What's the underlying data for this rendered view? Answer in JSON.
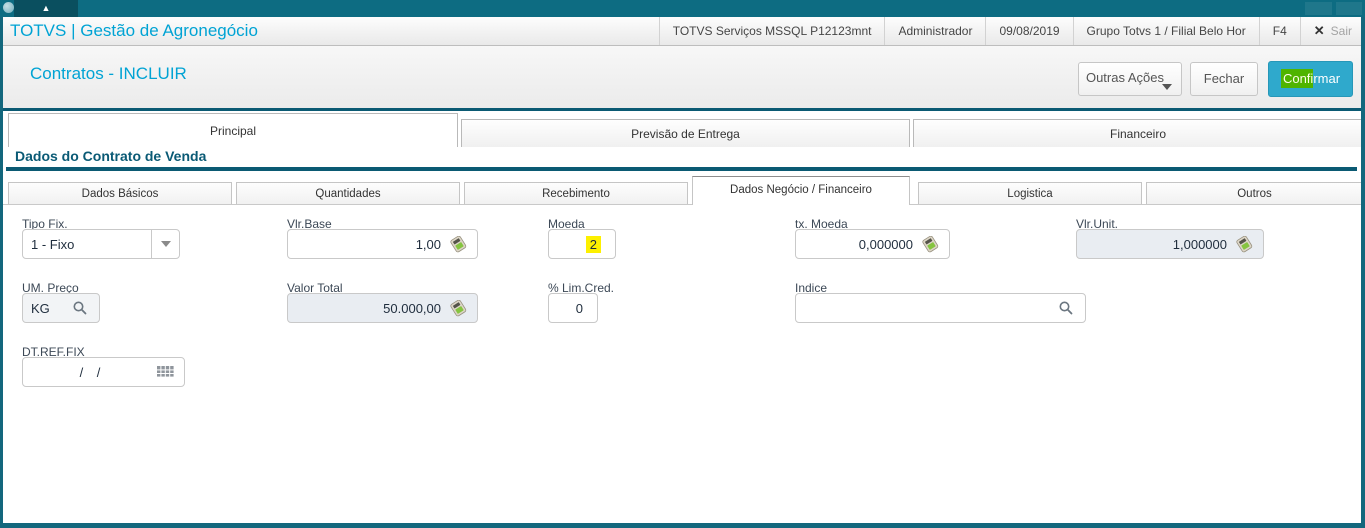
{
  "window": {
    "tab_indicator": "▲"
  },
  "titlebar": {
    "app_title": "TOTVS | Gestão de Agronegócio",
    "items": [
      "TOTVS Serviços MSSQL P12123mnt",
      "Administrador",
      "09/08/2019",
      "Grupo Totvs 1 / Filial Belo Hor",
      "F4"
    ],
    "close_symbol": "✕",
    "exit_label": "Sair"
  },
  "header": {
    "page_title": "Contratos - INCLUIR",
    "other_actions_label": "Outras Ações",
    "close_label": "Fechar",
    "confirm_label_highlight": "Confi",
    "confirm_label_rest": "rmar"
  },
  "tabs": [
    {
      "label": "Principal",
      "active": true
    },
    {
      "label": "Previsão de Entrega",
      "active": false
    },
    {
      "label": "Financeiro",
      "active": false
    }
  ],
  "section": {
    "title": "Dados do Contrato de Venda"
  },
  "subtabs": [
    {
      "label": "Dados Básicos",
      "active": false
    },
    {
      "label": "Quantidades",
      "active": false
    },
    {
      "label": "Recebimento",
      "active": false
    },
    {
      "label": "Dados Negócio / Financeiro",
      "active": true
    },
    {
      "label": "Logistica",
      "active": false
    },
    {
      "label": "Outros",
      "active": false
    }
  ],
  "form": {
    "tipo_fix": {
      "label": "Tipo Fix.",
      "value": "1 - Fixo"
    },
    "vlr_base": {
      "label": "Vlr.Base",
      "value": "1,00"
    },
    "moeda": {
      "label": "Moeda",
      "value": "2",
      "highlighted": true
    },
    "tx_moeda": {
      "label": "tx. Moeda",
      "value": "0,000000"
    },
    "vlr_unit": {
      "label": "Vlr.Unit.",
      "value": "1,000000",
      "disabled": true
    },
    "um_preco": {
      "label": "UM. Preço",
      "value": "KG"
    },
    "valor_total": {
      "label": "Valor Total",
      "value": "50.000,00",
      "disabled": true
    },
    "lim_cred": {
      "label": "% Lim.Cred.",
      "value": "0"
    },
    "indice": {
      "label": "Indice",
      "value": ""
    },
    "dt_ref_fix": {
      "label": "DT.REF.FIX",
      "value": "/ /"
    }
  },
  "colors": {
    "teal_top": "#0d6c82",
    "teal_frame": "#13677d",
    "teal_section": "#0b5a73",
    "accent_cyan": "#00a3d4",
    "confirm_button": "#2fa9cc",
    "find_highlight_green": "#4fb400",
    "find_highlight_yellow": "#fdf000",
    "disabled_field": "#e9edf2"
  }
}
